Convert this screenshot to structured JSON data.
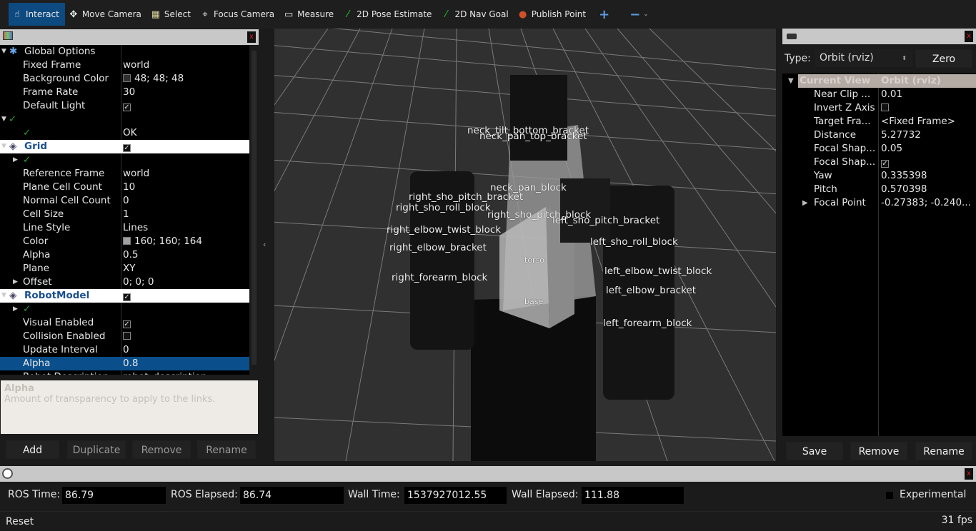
{
  "toolbar": {
    "tools": [
      {
        "label": "Interact",
        "icon": "hand-pointer-icon",
        "active": true
      },
      {
        "label": "Move Camera",
        "icon": "move-arrows-icon"
      },
      {
        "label": "Select",
        "icon": "select-box-icon"
      },
      {
        "label": "Focus Camera",
        "icon": "crosshair-icon"
      },
      {
        "label": "Measure",
        "icon": "ruler-icon"
      },
      {
        "label": "2D Pose Estimate",
        "icon": "green-arrow-icon"
      },
      {
        "label": "2D Nav Goal",
        "icon": "green-arrow-icon"
      },
      {
        "label": "Publish Point",
        "icon": "map-pin-icon"
      }
    ],
    "add_icon": "plus-icon",
    "remove_icon": "minus-icon"
  },
  "displays": {
    "rows": [
      {
        "key": "Global Options",
        "value": "",
        "type": "group"
      },
      {
        "key": "Fixed Frame",
        "value": "world"
      },
      {
        "key": "Background Color",
        "value": "48; 48; 48",
        "swatch": "#303030"
      },
      {
        "key": "Frame Rate",
        "value": "30"
      },
      {
        "key": "Default Light",
        "value": "",
        "check": true
      },
      {
        "key": "",
        "value": "",
        "status": true
      },
      {
        "key": "",
        "value": "OK",
        "status": true
      },
      {
        "key": "Grid",
        "value": "",
        "check": true,
        "type": "display"
      },
      {
        "key": "",
        "value": "",
        "status": true
      },
      {
        "key": "Reference Frame",
        "value": "world"
      },
      {
        "key": "Plane Cell Count",
        "value": "10"
      },
      {
        "key": "Normal Cell Count",
        "value": "0"
      },
      {
        "key": "Cell Size",
        "value": "1"
      },
      {
        "key": "Line Style",
        "value": "Lines"
      },
      {
        "key": "Color",
        "value": "160; 160; 164",
        "swatch": "#a0a0a4"
      },
      {
        "key": "Alpha",
        "value": "0.5"
      },
      {
        "key": "Plane",
        "value": "XY"
      },
      {
        "key": "Offset",
        "value": "0; 0; 0"
      },
      {
        "key": "RobotModel",
        "value": "",
        "check": true,
        "type": "display"
      },
      {
        "key": "",
        "value": "",
        "status": true
      },
      {
        "key": "Visual Enabled",
        "value": "",
        "check": true
      },
      {
        "key": "Collision Enabled",
        "value": "",
        "check": false
      },
      {
        "key": "Update Interval",
        "value": "0"
      },
      {
        "key": "Alpha",
        "value": "0.8",
        "selected": true
      },
      {
        "key": "Robot Description",
        "value": "robot_description"
      }
    ],
    "desc_title": "Alpha",
    "desc_text": "Amount of transparency to apply to the links.",
    "buttons": [
      "Add",
      "Duplicate",
      "Remove",
      "Rename"
    ]
  },
  "viewport": {
    "labels": [
      "neck_tilt_bottom_bracket",
      "neck_pan_top_bracket",
      "neck_pan_block",
      "right_sho_pitch_bracket",
      "right_sho_roll_block",
      "right_sho_pitch_block",
      "right_elbow_twist_block",
      "right_elbow_bracket",
      "right_forearm_block",
      "left_sho_pitch_bracket",
      "left_sho_roll_block",
      "left_elbow_twist_block",
      "left_elbow_bracket",
      "left_forearm_block",
      "torso",
      "base"
    ],
    "background": "#303030"
  },
  "views": {
    "type_label": "Type:",
    "type_value": "Orbit (rviz)",
    "zero": "Zero",
    "header": {
      "key": "Current View",
      "value": "Orbit (rviz)"
    },
    "rows": [
      {
        "key": "Near Clip ...",
        "value": "0.01"
      },
      {
        "key": "Invert Z Axis",
        "value": "",
        "check": false
      },
      {
        "key": "Target Fra...",
        "value": "<Fixed Frame>"
      },
      {
        "key": "Distance",
        "value": "5.27732"
      },
      {
        "key": "Focal Shap...",
        "value": "0.05"
      },
      {
        "key": "Focal Shap...",
        "value": "",
        "check": true
      },
      {
        "key": "Yaw",
        "value": "0.335398"
      },
      {
        "key": "Pitch",
        "value": "0.570398"
      },
      {
        "key": "Focal Point",
        "value": "-0.27383; -0.240..."
      }
    ],
    "buttons": [
      "Save",
      "Remove",
      "Rename"
    ]
  },
  "time": {
    "ros_time_label": "ROS Time:",
    "ros_time": "86.79",
    "ros_elapsed_label": "ROS Elapsed:",
    "ros_elapsed": "86.74",
    "wall_time_label": "Wall Time:",
    "wall_time": "1537927012.55",
    "wall_elapsed_label": "Wall Elapsed:",
    "wall_elapsed": "111.88",
    "experimental": "Experimental"
  },
  "status": {
    "reset": "Reset",
    "fps": "31 fps"
  }
}
